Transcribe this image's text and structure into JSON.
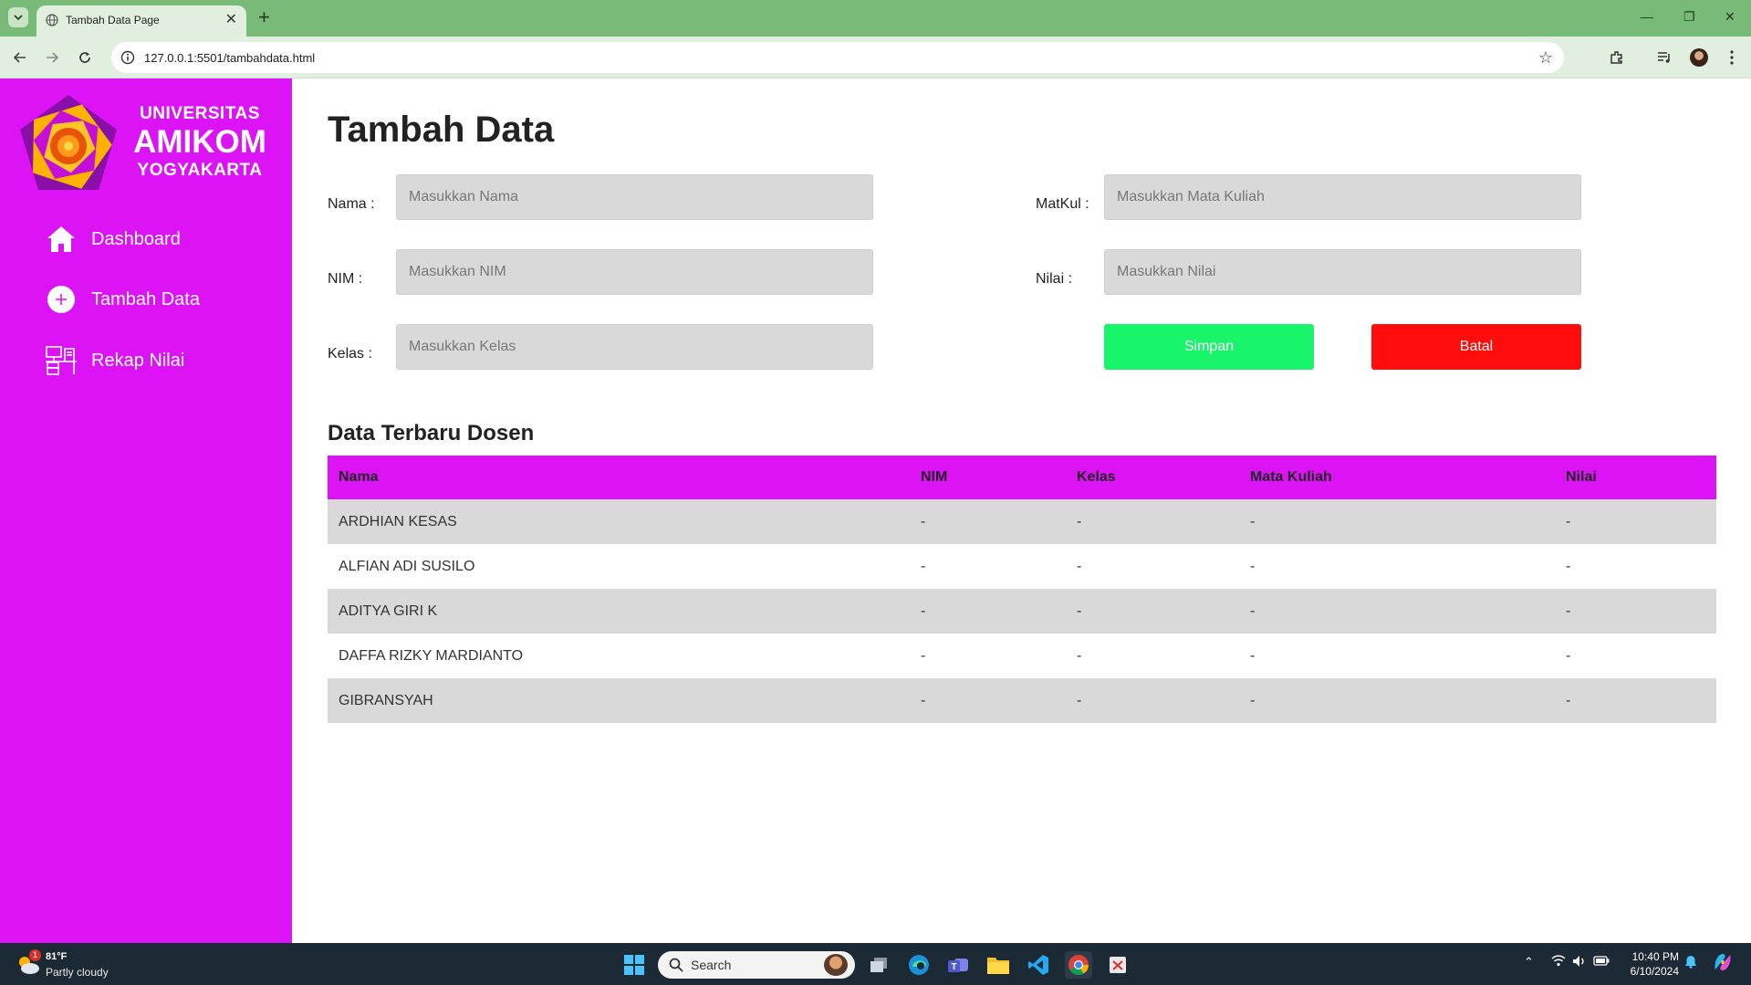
{
  "browser": {
    "tab_title": "Tambah Data Page",
    "url": "127.0.0.1:5501/tambahdata.html"
  },
  "sidebar": {
    "brand_line1": "UNIVERSITAS",
    "brand_line2": "AMIKOM",
    "brand_line3": "YOGYAKARTA",
    "items": [
      {
        "label": "Dashboard",
        "icon": "home-icon"
      },
      {
        "label": "Tambah Data",
        "icon": "plus-circle-icon"
      },
      {
        "label": "Rekap Nilai",
        "icon": "desk-icon"
      }
    ]
  },
  "main": {
    "title": "Tambah Data",
    "form": {
      "nama_label": "Nama :",
      "nama_placeholder": "Masukkan Nama",
      "nim_label": "NIM :",
      "nim_placeholder": "Masukkan NIM",
      "kelas_label": "Kelas :",
      "kelas_placeholder": "Masukkan Kelas",
      "matkul_label": "MatKul :",
      "matkul_placeholder": "Masukkan Mata Kuliah",
      "nilai_label": "Nilai :",
      "nilai_placeholder": "Masukkan Nilai",
      "save_label": "Simpan",
      "cancel_label": "Batal"
    },
    "table": {
      "title": "Data Terbaru Dosen",
      "headers": [
        "Nama",
        "NIM",
        "Kelas",
        "Mata Kuliah",
        "Nilai"
      ],
      "rows": [
        [
          "ARDHIAN KESAS",
          "-",
          "-",
          "-",
          "-"
        ],
        [
          "ALFIAN ADI SUSILO",
          "-",
          "-",
          "-",
          "-"
        ],
        [
          "ADITYA GIRI K",
          "-",
          "-",
          "-",
          "-"
        ],
        [
          "DAFFA RIZKY MARDIANTO",
          "-",
          "-",
          "-",
          "-"
        ],
        [
          "GIBRANSYAH",
          "-",
          "-",
          "-",
          "-"
        ]
      ]
    }
  },
  "taskbar": {
    "weather_temp": "81°F",
    "weather_desc": "Partly cloudy",
    "weather_badge": "1",
    "search_label": "Search",
    "time": "10:40 PM",
    "date": "6/10/2024"
  },
  "colors": {
    "sidebar_bg": "#dc13f5",
    "table_header_bg": "#dc13f5",
    "save_button": "#19f56a",
    "cancel_button": "#ff0d0d",
    "browser_frame": "#7aba78"
  }
}
